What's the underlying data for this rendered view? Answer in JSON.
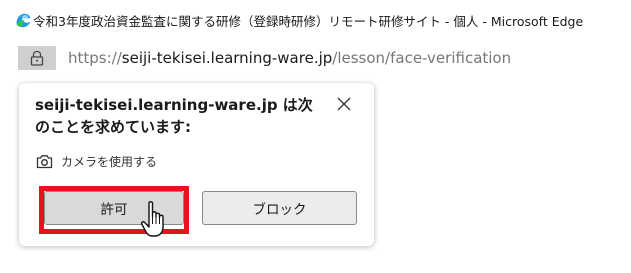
{
  "window": {
    "title": "令和3年度政治資金監査に関する研修（登録時研修）リモート研修サイト - 個人 - Microsoft Edge",
    "browser_logo_icon": "edge-logo-icon"
  },
  "address_bar": {
    "url_prefix": "https://",
    "url_host": "seiji-tekisei.learning-ware.jp",
    "url_path": "/lesson/face-verification",
    "lock_icon": "lock-icon"
  },
  "permission_prompt": {
    "title": "seiji-tekisei.learning-ware.jp は次のことを求めています:",
    "permission_label": "カメラを使用する",
    "permission_icon": "camera-icon",
    "close_icon": "close-icon",
    "allow_label": "許可",
    "block_label": "ブロック",
    "highlight_color": "#e8121e"
  }
}
